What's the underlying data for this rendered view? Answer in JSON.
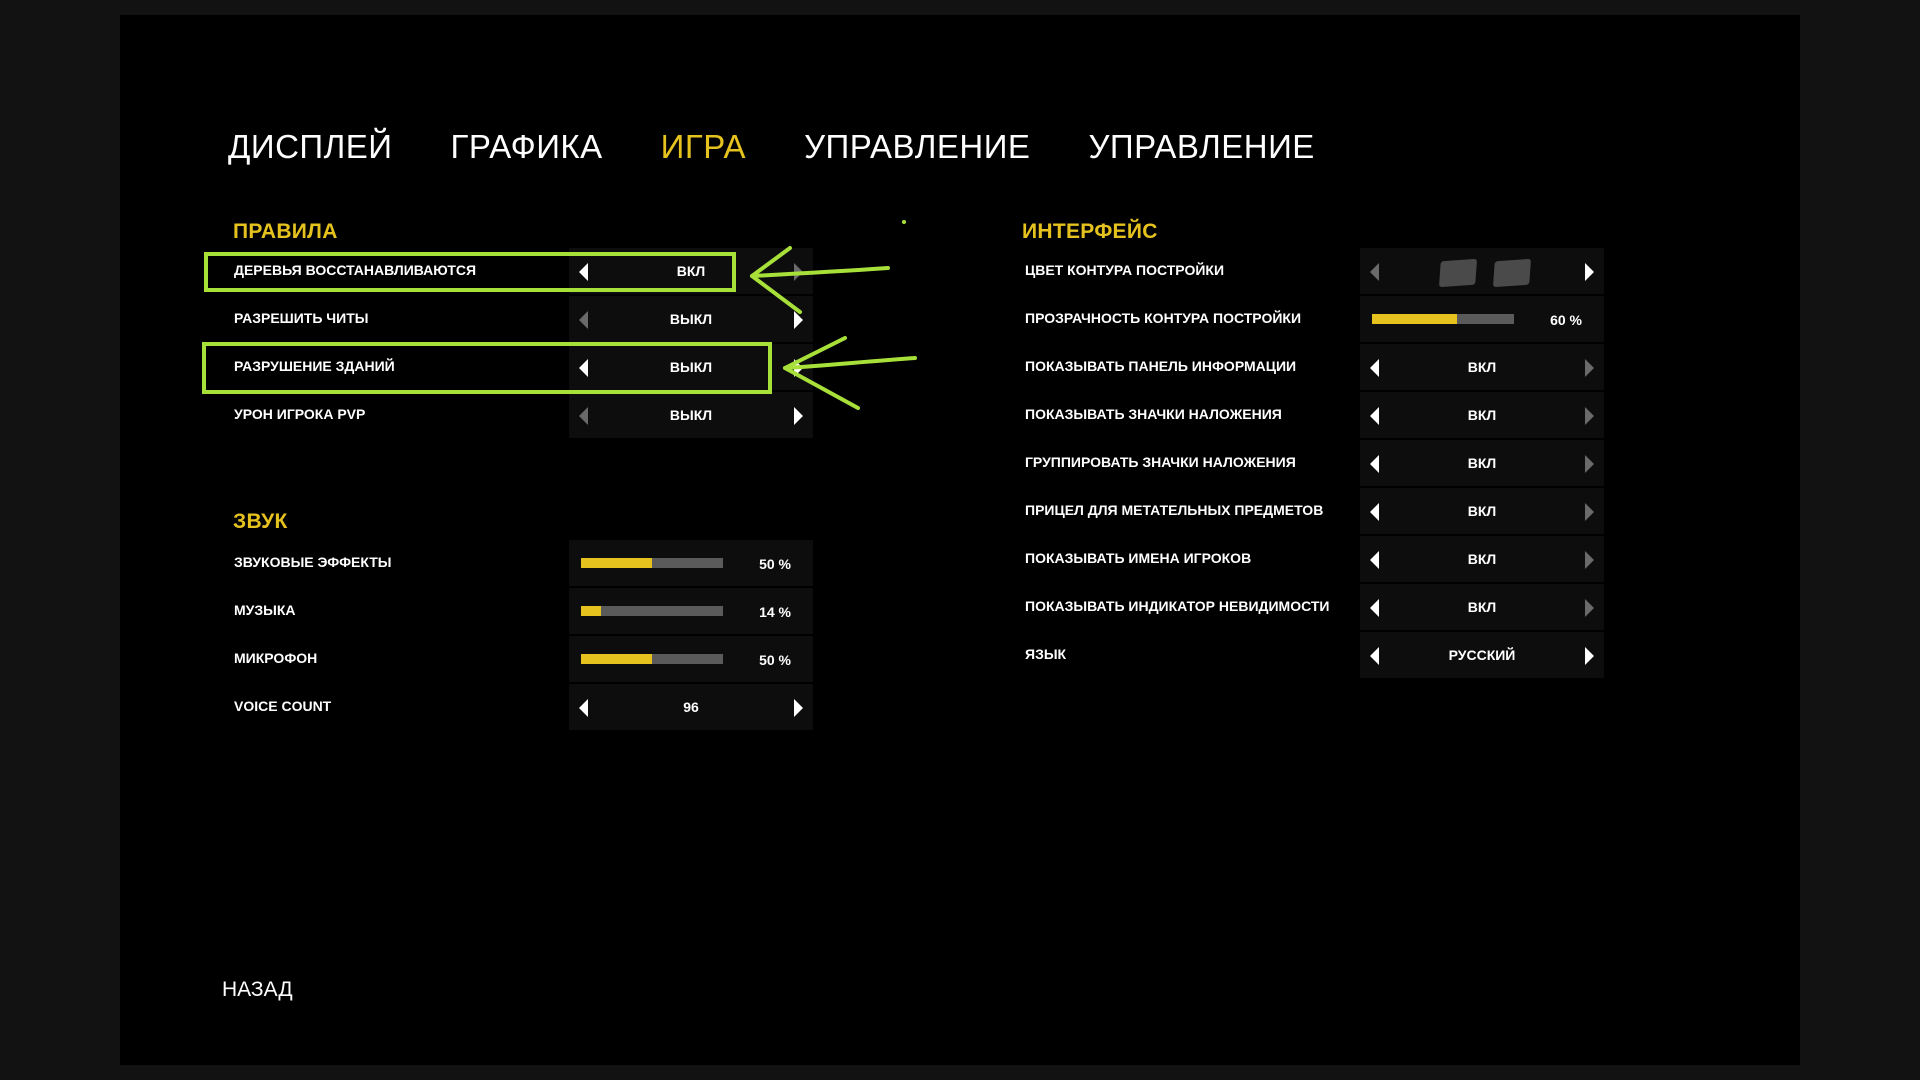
{
  "tabs": [
    {
      "label": "ДИСПЛЕЙ",
      "active": false
    },
    {
      "label": "ГРАФИКА",
      "active": false
    },
    {
      "label": "ИГРА",
      "active": true
    },
    {
      "label": "УПРАВЛЕНИЕ",
      "active": false
    },
    {
      "label": "УПРАВЛЕНИЕ",
      "active": false
    }
  ],
  "rules": {
    "title": "ПРАВИЛА",
    "items": [
      {
        "label": "ДЕРЕВЬЯ ВОССТАНАВЛИВАЮТСЯ",
        "value": "ВКЛ"
      },
      {
        "label": "РАЗРЕШИТЬ ЧИТЫ",
        "value": "ВЫКЛ"
      },
      {
        "label": "РАЗРУШЕНИЕ ЗДАНИЙ",
        "value": "ВЫКЛ"
      },
      {
        "label": "УРОН ИГРОКА PVP",
        "value": "ВЫКЛ"
      }
    ]
  },
  "sound": {
    "title": "ЗВУК",
    "items": [
      {
        "label": "ЗВУКОВЫЕ ЭФФЕКТЫ",
        "percent_text": "50 %",
        "level": 50
      },
      {
        "label": "МУЗЫКА",
        "percent_text": "14 %",
        "level": 14
      },
      {
        "label": "МИКРОФОН",
        "percent_text": "50 %",
        "level": 50
      },
      {
        "label": "VOICE COUNT",
        "value": "96"
      }
    ]
  },
  "interface": {
    "title": "ИНТЕРФЕЙС",
    "items": [
      {
        "label": "ЦВЕТ КОНТУРА ПОСТРОЙКИ",
        "swatch_color": "#4a4a4a"
      },
      {
        "label": "ПРОЗРАЧНОСТЬ КОНТУРА ПОСТРОЙКИ",
        "percent_text": "60 %",
        "level": 60
      },
      {
        "label": "ПОКАЗЫВАТЬ ПАНЕЛЬ ИНФОРМАЦИИ",
        "value": "ВКЛ"
      },
      {
        "label": "ПОКАЗЫВАТЬ ЗНАЧКИ НАЛОЖЕНИЯ",
        "value": "ВКЛ"
      },
      {
        "label": "ГРУППИРОВАТЬ ЗНАЧКИ НАЛОЖЕНИЯ",
        "value": "ВКЛ"
      },
      {
        "label": "ПРИЦЕЛ ДЛЯ МЕТАТЕЛЬНЫХ ПРЕДМЕТОВ",
        "value": "ВКЛ"
      },
      {
        "label": "ПОКАЗЫВАТЬ ИМЕНА ИГРОКОВ",
        "value": "ВКЛ"
      },
      {
        "label": "ПОКАЗЫВАТЬ ИНДИКАТОР НЕВИДИМОСТИ",
        "value": "ВКЛ"
      },
      {
        "label": "ЯЗЫК",
        "value": "РУССКИЙ"
      }
    ]
  },
  "back_label": "НАЗАД",
  "colors": {
    "accent": "#e6c21f",
    "annotation": "#a8e03a",
    "background": "#000000"
  }
}
